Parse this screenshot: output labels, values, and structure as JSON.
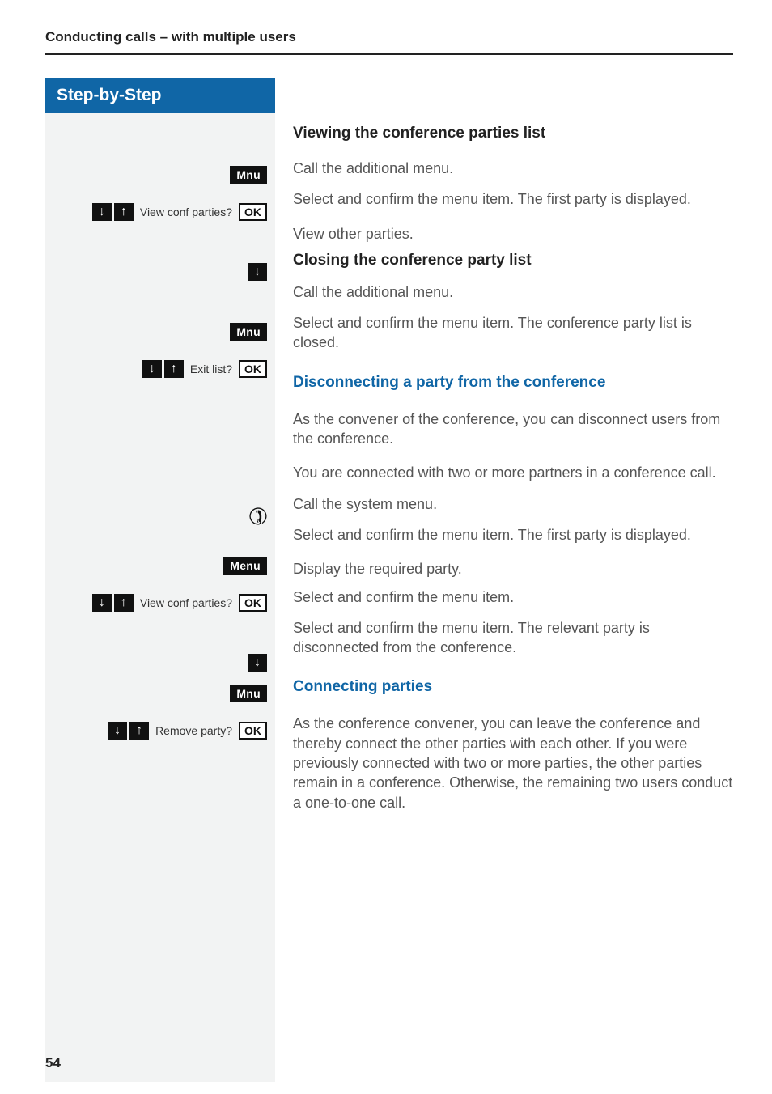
{
  "header": {
    "section_title": "Conducting calls – with multiple users",
    "sidebar_title": "Step-by-Step"
  },
  "keys": {
    "mnu": "Mnu",
    "menu": "Menu",
    "ok": "OK"
  },
  "icons": {
    "down": "↓",
    "up": "↑",
    "phone": "✆"
  },
  "labels": {
    "view_conf": "View conf parties?",
    "exit_list": "Exit list?",
    "remove_party": "Remove party?"
  },
  "content": {
    "h1": "Viewing the conference parties list",
    "p1": "Call the additional menu.",
    "p2": "Select and confirm the menu item. The first party is displayed.",
    "p3": "View other parties.",
    "h2": "Closing the conference party list",
    "p4": "Call the additional menu.",
    "p5": "Select and confirm the menu item. The conference party list is closed.",
    "h3": "Disconnecting a party from the conference",
    "p6": "As the convener of the conference, you can disconnect users from the conference.",
    "p7": "You are connected with two or more partners in a conference call.",
    "p8": "Call the system menu.",
    "p9": "Select and confirm the menu item. The first party is displayed.",
    "p10": "Display the required party.",
    "p11": "Select and confirm the menu item.",
    "p12": "Select and confirm the menu item. The relevant party is disconnected from the conference.",
    "h4": "Connecting parties",
    "p13": "As the conference convener, you can leave the conference and thereby connect the other parties with each other. If you were previously connected with two or more parties, the other parties remain in a conference. Otherwise, the remaining two users conduct a one-to-one call."
  },
  "page_number": "54"
}
